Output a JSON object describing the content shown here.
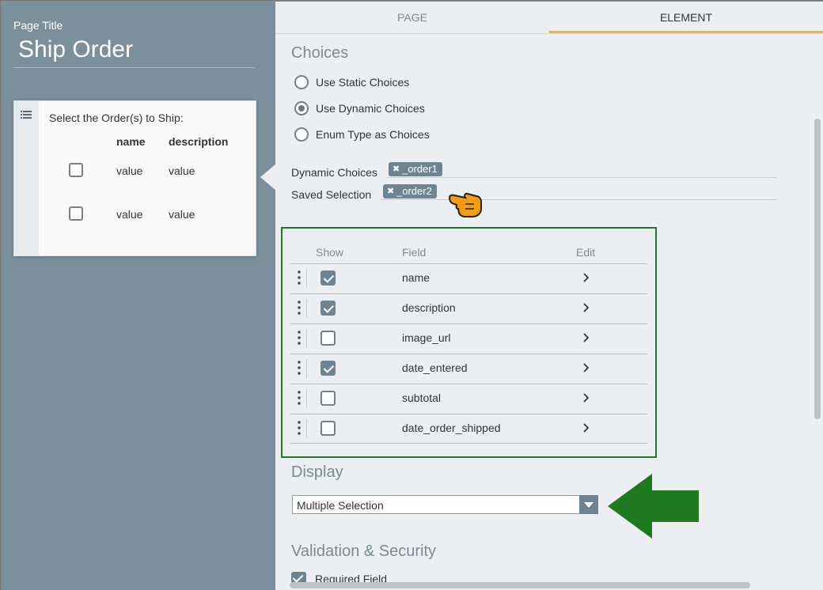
{
  "page_title": {
    "label": "Page Title",
    "value": "Ship Order"
  },
  "preview": {
    "title": "Select the Order(s) to Ship:",
    "columns": [
      "name",
      "description"
    ],
    "rows": [
      {
        "name": "value",
        "description": "value"
      },
      {
        "name": "value",
        "description": "value"
      }
    ]
  },
  "tabs": [
    {
      "label": "PAGE",
      "active": false
    },
    {
      "label": "ELEMENT",
      "active": true
    }
  ],
  "choices": {
    "title": "Choices",
    "options": [
      {
        "label": "Use Static Choices",
        "selected": false
      },
      {
        "label": "Use Dynamic Choices",
        "selected": true
      },
      {
        "label": "Enum Type as Choices",
        "selected": false
      }
    ],
    "dynamic_choices": {
      "label": "Dynamic Choices",
      "chip": "_order1"
    },
    "saved_selection": {
      "label": "Saved Selection",
      "chip": "_order2"
    }
  },
  "fields_table": {
    "headers": {
      "show": "Show",
      "field": "Field",
      "edit": "Edit"
    },
    "rows": [
      {
        "field": "name",
        "show": true
      },
      {
        "field": "description",
        "show": true
      },
      {
        "field": "image_url",
        "show": false
      },
      {
        "field": "date_entered",
        "show": true
      },
      {
        "field": "subtotal",
        "show": false
      },
      {
        "field": "date_order_shipped",
        "show": false
      }
    ]
  },
  "display": {
    "title": "Display",
    "value": "Multiple Selection"
  },
  "validation": {
    "title": "Validation & Security",
    "required_label": "Required Field",
    "required": true
  },
  "colors": {
    "accent": "#f0b71e",
    "highlight_box": "#1e7a1e",
    "canvas": "#7b8f9c"
  },
  "icons": [
    "list-icon",
    "close-icon",
    "pointing-hand-icon",
    "drag-handle-icon",
    "chevron-right-icon",
    "dropdown-arrow-icon",
    "arrow-left-icon"
  ]
}
